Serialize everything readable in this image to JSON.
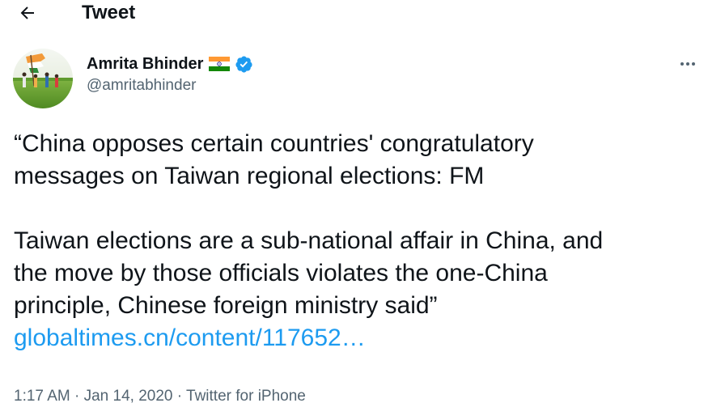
{
  "header": {
    "back_icon": "arrow-left-icon",
    "title": "Tweet"
  },
  "author": {
    "display_name": "Amrita Bhinder",
    "flag_icon": "india-flag-icon",
    "verified_icon": "verified-badge-icon",
    "handle": "@amritabhinder",
    "avatar": "avatar-icon"
  },
  "more_icon": "more-options-icon",
  "tweet": {
    "paragraph_1_line_1": "“China opposes certain countries' congratulatory",
    "paragraph_1_line_2": "messages on Taiwan regional elections: FM",
    "paragraph_2_line_1": "Taiwan elections are a sub-national affair in China, and",
    "paragraph_2_line_2": "the move by those officials violates the one-China",
    "paragraph_2_line_3": "principle, Chinese foreign ministry said”",
    "link_text": "globaltimes.cn/content/117652…"
  },
  "meta": {
    "time": "1:17 AM",
    "separator_1": " · ",
    "date": "Jan 14, 2020",
    "separator_2": " · ",
    "source": "Twitter for iPhone"
  },
  "colors": {
    "link": "#1d9bf0",
    "secondary_text": "#536471",
    "verified": "#1d9bf0"
  }
}
